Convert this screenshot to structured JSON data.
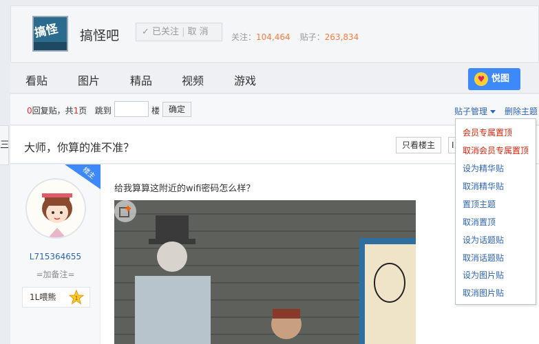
{
  "header": {
    "logo_text": "搞怪吧",
    "bar_name": "搞怪吧",
    "follow_label": "已关注",
    "unfollow_label": "取 消",
    "followers_label": "关注：",
    "followers_value": "104,464",
    "posts_label": "贴子：",
    "posts_value": "263,834"
  },
  "nav": {
    "items": [
      "看贴",
      "图片",
      "精品",
      "视频",
      "游戏"
    ],
    "yuetu_label": "悦图"
  },
  "pager": {
    "reply_count": "0",
    "text_a": "回复贴，共",
    "page_count": "1",
    "text_b": "页",
    "jump_label": "跳到",
    "lou_label": "楼",
    "confirm_label": "确定",
    "manage_label": "贴子管理",
    "delete_label": "删除主题"
  },
  "side_tab": "三",
  "thread": {
    "title": "大师，你算的准不准？",
    "only_louzhu": "只看楼主",
    "cut_btn": "I"
  },
  "post": {
    "badge": "楼主",
    "username": "L715364655",
    "add_note": "=加备注=",
    "level_label": "1L喂熊",
    "level_num": "1",
    "content": "给我算算这附近的wifi密码怎么样？"
  },
  "dropdown": {
    "items": [
      {
        "label": "会员专属置顶",
        "color": "red"
      },
      {
        "label": "取消会员专属置顶",
        "color": "red"
      },
      {
        "label": "设为精华贴",
        "color": "blue"
      },
      {
        "label": "取消精华贴",
        "color": "blue"
      },
      {
        "label": "置顶主题",
        "color": "blue"
      },
      {
        "label": "取消置顶",
        "color": "blue"
      },
      {
        "label": "设为话题贴",
        "color": "blue"
      },
      {
        "label": "取消话题贴",
        "color": "blue"
      },
      {
        "label": "设为图片贴",
        "color": "blue"
      },
      {
        "label": "取消图片贴",
        "color": "blue"
      }
    ]
  },
  "colors": {
    "accent_blue": "#3e89fa",
    "link_blue": "#2d64b3",
    "stat_orange": "#ff7a3d",
    "danger_red": "#d3250b"
  }
}
